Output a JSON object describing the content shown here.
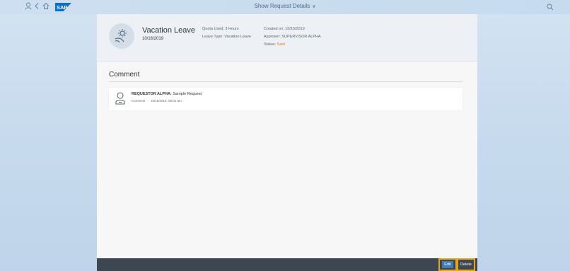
{
  "shell": {
    "title": "Show Request Details",
    "icons": [
      "person-icon",
      "back-icon",
      "home-icon",
      "search-icon"
    ],
    "logo_text": "SAP",
    "chevron": "∨"
  },
  "header": {
    "title": "Vacation Leave",
    "date": "10/16/2019",
    "quota_used": "Quota Used: 3 Hours",
    "leave_type": "Leave Type: Vacation Leave",
    "created_on": "Created on: 10/15/2019",
    "approver": "Approver: SUPERVISOR ALPHA",
    "status_label": "Status:",
    "status_value": "Sent",
    "icon": "vacation-sun-icon"
  },
  "comments": {
    "heading": "Comment",
    "items": [
      {
        "author": "REQUESTOR ALPHA:",
        "text": "Sample Request",
        "type": "Comment",
        "timestamp": "10/15/2019, 08:01 am"
      }
    ]
  },
  "footer": {
    "edit_label": "Edit",
    "delete_label": "Delete"
  },
  "colors": {
    "status": "#e9730c",
    "footer_bg": "#3d4751",
    "highlight": "#e8a317",
    "edit_bg": "#3f7cb6"
  }
}
